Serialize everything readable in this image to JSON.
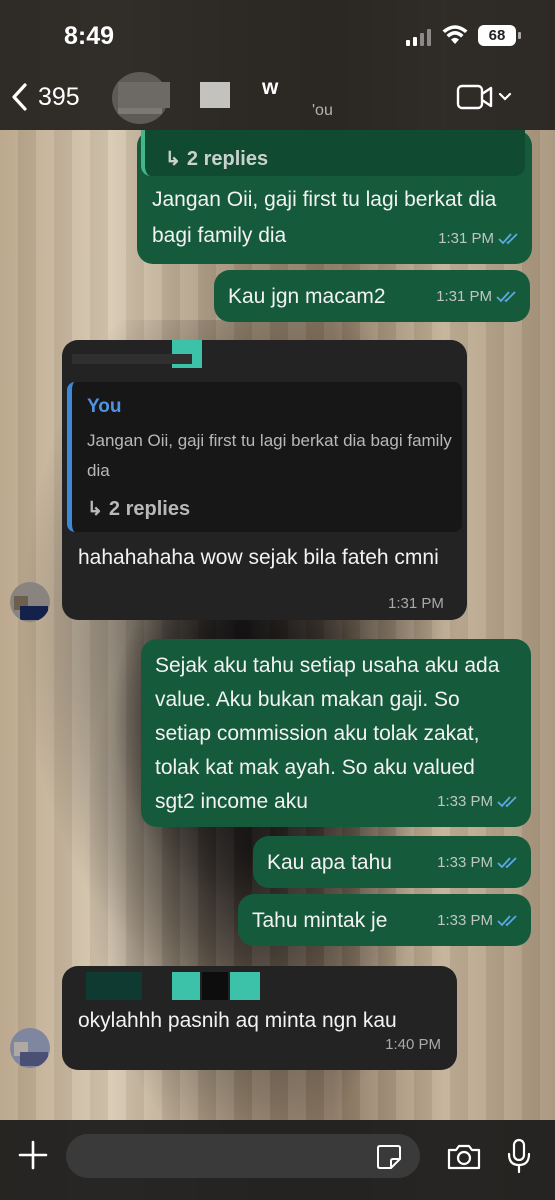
{
  "status_bar": {
    "time": "8:49",
    "battery": "68"
  },
  "header": {
    "back_count": "395",
    "contact_name_partial": "w",
    "contact_subtitle_partial": "'ou"
  },
  "messages": [
    {
      "direction": "outgoing",
      "quote_replies": "2 replies",
      "text": "Jangan Oii, gaji first tu lagi berkat dia bagi family dia",
      "time": "1:31 PM"
    },
    {
      "direction": "outgoing",
      "text": "Kau jgn macam2",
      "time": "1:31 PM"
    },
    {
      "direction": "incoming",
      "quote_author": "You",
      "quote_text": "Jangan Oii, gaji first tu lagi berkat dia bagi family dia",
      "quote_replies": "2 replies",
      "text": "hahahahaha wow sejak bila fateh cmni",
      "time": "1:31 PM"
    },
    {
      "direction": "outgoing",
      "text": "Sejak aku tahu setiap usaha aku ada value. Aku bukan makan gaji. So setiap commission aku tolak zakat, tolak kat mak ayah. So aku valued sgt2 income aku",
      "time": "1:33 PM"
    },
    {
      "direction": "outgoing",
      "text": "Kau apa tahu",
      "time": "1:33 PM"
    },
    {
      "direction": "outgoing",
      "text": "Tahu mintak je",
      "time": "1:33 PM"
    },
    {
      "direction": "incoming",
      "text": "okylahhh pasnih aq minta ngn kau",
      "time": "1:40 PM"
    }
  ],
  "composer": {
    "placeholder": ""
  },
  "colors": {
    "outgoing_bubble": "#165a3c",
    "incoming_bubble": "#232323",
    "quote_author": "#4f93e0",
    "read_ticks": "#5aa8e8"
  },
  "icons": [
    "chevron-left-icon",
    "video-camera-icon",
    "chevron-down-icon",
    "reply-arrow-icon",
    "double-check-icon",
    "plus-icon",
    "sticker-icon",
    "camera-icon",
    "microphone-icon"
  ]
}
